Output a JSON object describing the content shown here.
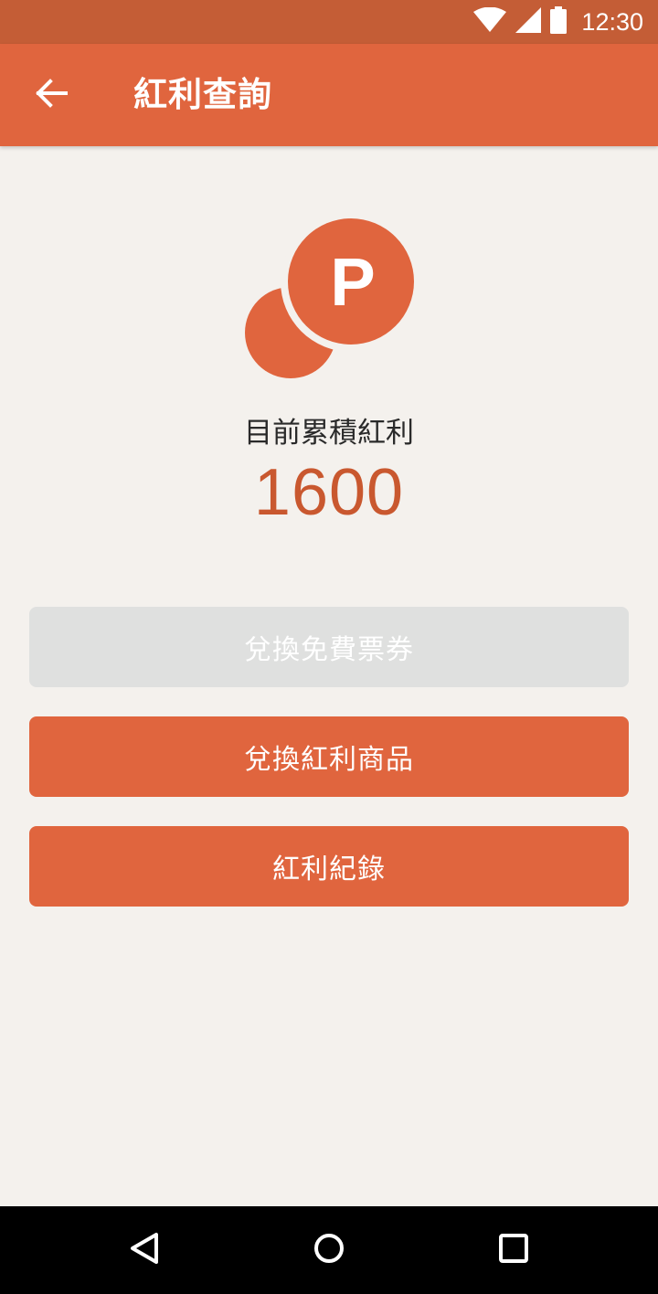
{
  "status_bar": {
    "time": "12:30",
    "icons": [
      "wifi-icon",
      "signal-icon",
      "battery-icon"
    ]
  },
  "app_bar": {
    "back_icon": "arrow-left-icon",
    "title": "紅利查詢"
  },
  "points": {
    "icon": "points-coin-icon",
    "icon_letter": "P",
    "caption": "目前累積紅利",
    "value": "1600"
  },
  "actions": {
    "redeem_ticket_label": "兌換免費票券",
    "redeem_goods_label": "兌換紅利商品",
    "history_label": "紅利紀錄"
  },
  "nav_bar": {
    "icons": [
      "back-triangle-icon",
      "home-circle-icon",
      "recents-square-icon"
    ]
  },
  "colors": {
    "primary": "#e0653e",
    "status_bar": "#c45d36",
    "background": "#f4f1ed",
    "disabled": "#dfe0df",
    "points_text": "#c9582f"
  }
}
